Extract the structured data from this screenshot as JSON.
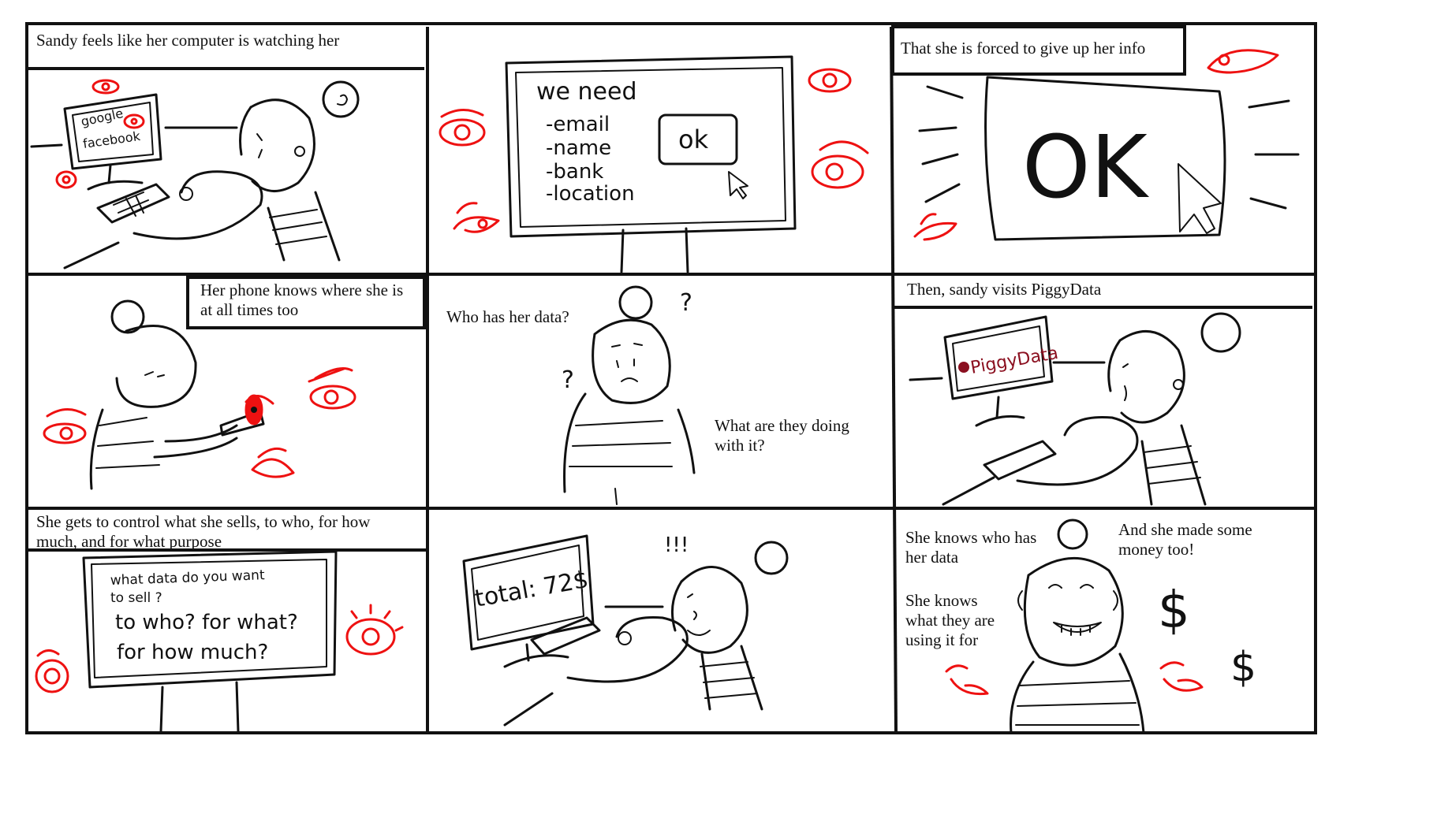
{
  "panels": [
    {
      "caption": "Sandy feels like her computer is watching her",
      "screen_lines": [
        "google",
        "facebook"
      ]
    },
    {
      "screen_heading": "we need",
      "screen_items": [
        "-email",
        "-name",
        "-bank",
        "-location"
      ],
      "button_label": "ok"
    },
    {
      "caption": "That she is forced to give up her info",
      "button_label": "OK"
    },
    {
      "caption": "Her phone knows where she is\nat all times too"
    },
    {
      "caption_left": "Who has her data?",
      "caption_right": "What are they doing\nwith it?",
      "question_marks": [
        "?",
        "?"
      ]
    },
    {
      "caption": "Then, sandy visits PiggyData",
      "screen_brand": "PiggyData"
    },
    {
      "caption": "She gets to control what she sells, to who, for how\nmuch, and for what purpose",
      "screen_lines": [
        "what data do you want",
        "to sell ?",
        "to who? for what?",
        "for how much?"
      ]
    },
    {
      "screen_text": "total: 72$",
      "exclaim": "!!!"
    },
    {
      "caption_a": "She knows who has\nher data",
      "caption_b": "She knows\nwhat they are\nusing it for",
      "caption_c": "And she made some\nmoney too!",
      "symbols": [
        "$",
        "$"
      ]
    }
  ],
  "colors": {
    "ink": "#111111",
    "eye_red": "#ee1111",
    "brand_red": "#8b1020",
    "background": "#ffffff"
  }
}
